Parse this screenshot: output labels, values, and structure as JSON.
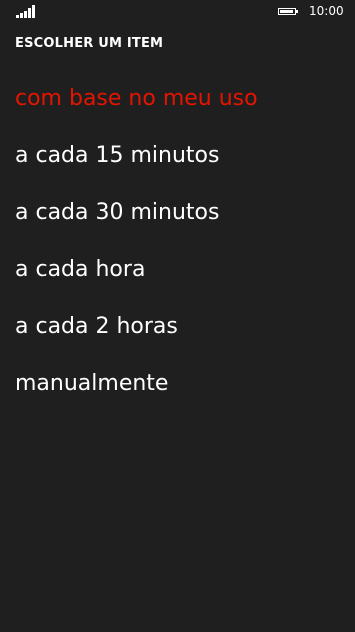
{
  "status_bar": {
    "time": "10:00",
    "icons": [
      "signal-strength-icon",
      "battery-icon"
    ]
  },
  "picker": {
    "title": "ESCOLHER UM ITEM",
    "accent_color": "#e51400",
    "selected_index": 0,
    "items": [
      {
        "label": "com base no meu uso"
      },
      {
        "label": "a cada 15 minutos"
      },
      {
        "label": "a cada 30 minutos"
      },
      {
        "label": "a cada hora"
      },
      {
        "label": "a cada 2 horas"
      },
      {
        "label": "manualmente"
      }
    ]
  }
}
